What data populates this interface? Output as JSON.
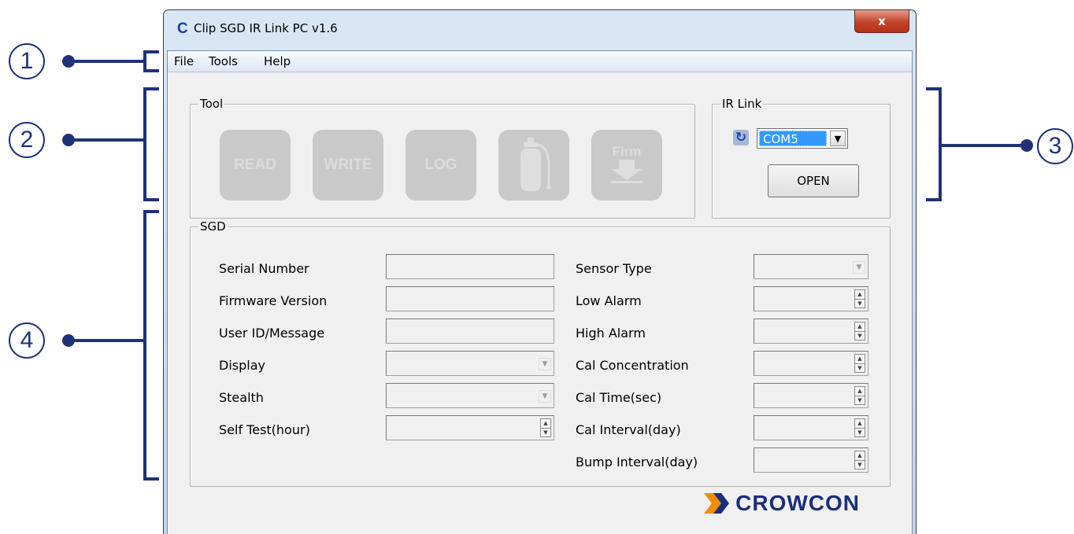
{
  "annotations": [
    "1",
    "2",
    "3",
    "4"
  ],
  "colors": {
    "annotation": "#1f3278",
    "brand": "#1a2e7c",
    "brand_accent": "#f28c00",
    "selection": "#3399ff"
  },
  "window": {
    "title": "Clip SGD IR Link PC v1.6",
    "app_icon": "C",
    "close_label": "x"
  },
  "menu": {
    "items": [
      "File",
      "Tools",
      "Help"
    ]
  },
  "tool_group": {
    "title": "Tool",
    "buttons": [
      {
        "label": "READ",
        "icon": "read-icon",
        "enabled": false
      },
      {
        "label": "WRITE",
        "icon": "write-icon",
        "enabled": false
      },
      {
        "label": "LOG",
        "icon": "log-icon",
        "enabled": false
      },
      {
        "label": "",
        "icon": "gas-cylinder-icon",
        "enabled": false
      },
      {
        "label": "Firm",
        "icon": "firmware-download-icon",
        "enabled": false
      }
    ]
  },
  "ir_link": {
    "title": "IR Link",
    "refresh_icon": "refresh-icon",
    "port_value": "COM5",
    "open_label": "OPEN"
  },
  "sgd": {
    "title": "SGD",
    "left_fields": [
      {
        "label": "Serial Number",
        "type": "text",
        "value": ""
      },
      {
        "label": "Firmware Version",
        "type": "text",
        "value": ""
      },
      {
        "label": "User ID/Message",
        "type": "text",
        "value": ""
      },
      {
        "label": "Display",
        "type": "dropdown",
        "value": ""
      },
      {
        "label": "Stealth",
        "type": "dropdown",
        "value": ""
      },
      {
        "label": "Self Test(hour)",
        "type": "spinner",
        "value": ""
      }
    ],
    "right_fields": [
      {
        "label": "Sensor Type",
        "type": "dropdown",
        "value": ""
      },
      {
        "label": "Low Alarm",
        "type": "spinner",
        "value": ""
      },
      {
        "label": "High Alarm",
        "type": "spinner",
        "value": ""
      },
      {
        "label": "Cal Concentration",
        "type": "spinner",
        "value": ""
      },
      {
        "label": "Cal Time(sec)",
        "type": "spinner",
        "value": ""
      },
      {
        "label": "Cal Interval(day)",
        "type": "spinner",
        "value": ""
      },
      {
        "label": "Bump Interval(day)",
        "type": "spinner",
        "value": ""
      }
    ]
  },
  "logo": {
    "text": "CROWCON"
  }
}
